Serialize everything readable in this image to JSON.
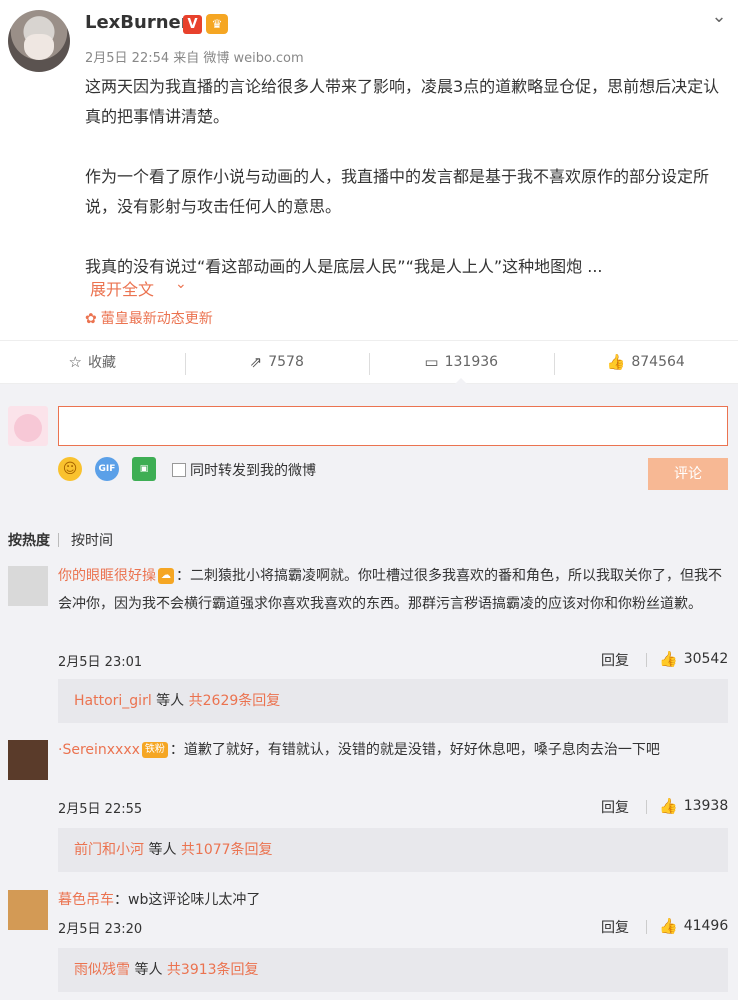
{
  "post": {
    "author": "LexBurner",
    "verified_badge": "V",
    "meta": "2月5日 22:54 来自 微博 weibo.com",
    "paragraphs": [
      "这两天因为我直播的言论给很多人带来了影响，凌晨3点的道歉略显仓促，思前想后决定认真的把事情讲清楚。",
      "作为一个看了原作小说与动画的人，我直播中的发言都是基于我不喜欢原作的部分设定所说，没有影射与攻击任何人的意思。",
      "我真的没有说过“看这部动画的人是底层人民”“我是人上人”这种地图炮 ..."
    ],
    "expand_label": "展开全文",
    "news_label": "蕾皇最新动态更新",
    "icons": {
      "more": "chevron-down-icon",
      "expand": "chevron-down-icon",
      "news": "flower-icon"
    }
  },
  "actions": [
    {
      "icon": "star-icon",
      "glyph": "☆",
      "label": "收藏"
    },
    {
      "icon": "share-icon",
      "glyph": "⇗",
      "label": "7578"
    },
    {
      "icon": "comment-icon",
      "glyph": "▭",
      "label": "131936"
    },
    {
      "icon": "like-icon",
      "glyph": "👍",
      "label": "874564"
    }
  ],
  "composer": {
    "input_value": "",
    "input_placeholder": "",
    "emoji_icon": "emoji-icon",
    "gif_label": "GIF",
    "repost_label": "同时转发到我的微博",
    "submit_label": "评论"
  },
  "sort": {
    "hot": "按热度",
    "time": "按时间"
  },
  "comments": [
    {
      "name": "你的眼眶很好操",
      "badge": "☁",
      "text": "：二刺猿批小将搞霸凌啊就。你吐槽过很多我喜欢的番和角色，所以我取关你了，但我不会冲你，因为我不会横行霸道强求你喜欢我喜欢的东西。那群污言秽语搞霸凌的应该对你和你粉丝道歉。",
      "time": "2月5日 23:01",
      "reply": "回复",
      "likes": "30542",
      "sub_who": "Hattori_girl",
      "sub_mid": " 等人 ",
      "sub_count": "共2629条回复"
    },
    {
      "name": "·Sereinxxxx",
      "badge": "铁粉",
      "text": "：道歉了就好，有错就认，没错的就是没错，好好休息吧，嗓子息肉去治一下吧",
      "time": "2月5日 22:55",
      "reply": "回复",
      "likes": "13938",
      "sub_who": "前门和小河",
      "sub_mid": " 等人 ",
      "sub_count": "共1077条回复"
    },
    {
      "name": "暮色吊车",
      "badge": "",
      "text": "：wb这评论味儿太冲了",
      "time": "2月5日 23:20",
      "reply": "回复",
      "likes": "41496",
      "sub_who": "雨似残雪",
      "sub_mid": " 等人 ",
      "sub_count": "共3913条回复"
    }
  ]
}
